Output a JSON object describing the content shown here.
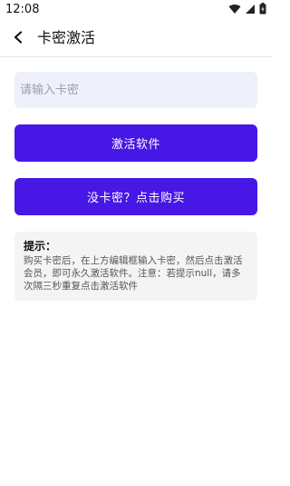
{
  "status_bar": {
    "time": "12:08",
    "icons": [
      "wifi-icon",
      "signal-icon",
      "battery-icon"
    ]
  },
  "header": {
    "back_icon": "back-arrow-icon",
    "title": "卡密激活"
  },
  "form": {
    "key_input": {
      "placeholder": "请输入卡密",
      "value": ""
    },
    "activate_button_label": "激活软件",
    "buy_button_label": "没卡密？点击购买"
  },
  "tips": {
    "title": "提示：",
    "body": "购买卡密后，在上方编辑框输入卡密，然后点击激活会员，即可永久激活软件。注意：若提示null，请多次隔三秒重复点击激活软件"
  },
  "colors": {
    "accent": "#4717e6",
    "input_bg": "#eef1fb",
    "tips_bg": "#f4f4f4"
  }
}
